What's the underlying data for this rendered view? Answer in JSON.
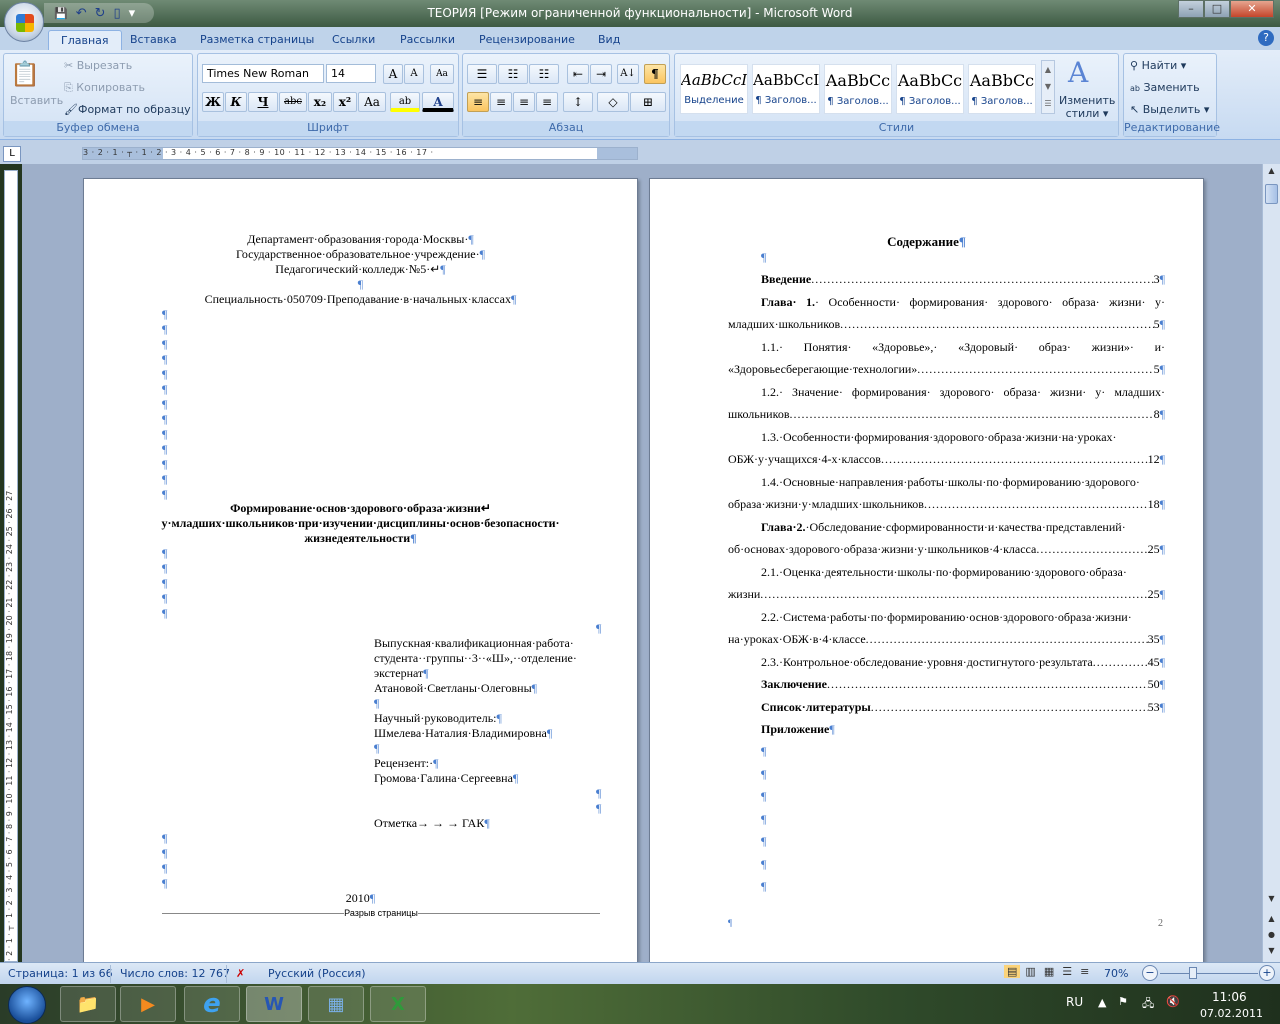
{
  "window": {
    "title": "ТЕОРИЯ [Режим ограниченной функциональности] - Microsoft Word",
    "minimize": "–",
    "maximize": "□",
    "close": "✕"
  },
  "qat": {
    "save": "💾",
    "undo": "↶",
    "redo": "↻",
    "new": "▯",
    "customize": "▾"
  },
  "tabs": [
    "Главная",
    "Вставка",
    "Разметка страницы",
    "Ссылки",
    "Рассылки",
    "Рецензирование",
    "Вид"
  ],
  "help": "?",
  "clipboard": {
    "paste": "Вставить",
    "cut": "Вырезать",
    "copy": "Копировать",
    "format_painter": "Формат по образцу",
    "label": "Буфер обмена"
  },
  "font": {
    "name": "Times New Roman",
    "size": "14",
    "grow": "A",
    "shrink": "A",
    "clear": "Aa",
    "bold": "Ж",
    "italic": "К",
    "underline": "Ч",
    "strike": "abc",
    "sub": "x₂",
    "sup": "x²",
    "case": "Aa",
    "highlight": "ab",
    "color": "A",
    "label": "Шрифт"
  },
  "paragraph": {
    "bullets": "☰",
    "numbering": "☷",
    "multilevel": "☷",
    "dec_indent": "⇤",
    "inc_indent": "⇥",
    "sort": "A↓",
    "show_marks": "¶",
    "align_left": "≡",
    "center": "≡",
    "align_right": "≡",
    "justify": "≡",
    "spacing": "↕",
    "shading": "◇",
    "borders": "⊞",
    "label": "Абзац"
  },
  "styles": {
    "items": [
      {
        "sample": "AaBbCcI",
        "name": "Выделение"
      },
      {
        "sample": "AaBbCcI",
        "name": "¶ Заголов..."
      },
      {
        "sample": "AaBbCc",
        "name": "¶ Заголов..."
      },
      {
        "sample": "AaBbCc",
        "name": "¶ Заголов..."
      },
      {
        "sample": "AaBbCc",
        "name": "¶ Заголов..."
      }
    ],
    "change": "Изменить стили ▾",
    "label": "Стили"
  },
  "editing": {
    "find": "Найти ▾",
    "replace": "Заменить",
    "select": "Выделить ▾",
    "label": "Редактирование"
  },
  "ruler": {
    "tab_selector": "L",
    "h": "3 · 2 · 1 · ┬ · 1 · 2 · 3 · 4 · 5 · 6 · 7 · 8 · 9 · 10 · 11 · 12 · 13 · 14 · 15 · 16 · 17 ·",
    "v": "· 2 · 1 · ┬ · 1 · 2 · 3 · 4 · 5 · 6 · 7 · 8 · 9 · 10 · 11 · 12 · 13 · 14 · 15 · 16 · 17 · 18 · 19 · 20 · 21 · 22 · 23 · 24 · 25 · 26 · 27 ·"
  },
  "page1": {
    "header": [
      "Департамент·образования·города·Москвы·",
      "Государственное·образовательное·учреждение·",
      "Педагогический·колледж·№5·↵",
      "",
      "Специальность·050709·Преподавание·в·начальных·классах"
    ],
    "title": [
      "Формирование·основ·здорового·образа·жизни↵",
      "у·младших·школьников·при·изучении·дисциплины·основ·безопасности·",
      "жизнедеятельности"
    ],
    "info": [
      "Выпускная·квалификационная·работа·",
      "студента··группы··3··«Ш»,··отделение·",
      "экстернат",
      "Атановой·Светланы·Олеговны",
      "",
      "Научный·руководитель:",
      "Шмелева·Наталия·Владимировна",
      "",
      "Рецензент:·",
      "Громова·Галина·Сергеевна"
    ],
    "mark": "Отметка→   →      →   ГАК",
    "year": "2010",
    "page_break": "Разрыв страницы",
    "pilcrow": "¶"
  },
  "page2": {
    "heading": "Содержание",
    "toc": [
      {
        "lines": [
          {
            "bold": "Введение",
            "text": "",
            "page": "3"
          }
        ]
      },
      {
        "lines": [
          {
            "bold": "Глава· 1.",
            "text": "· Особенности· формирования· здорового· образа· жизни· у·",
            "page": null
          },
          {
            "bold": "",
            "text": "младших·школьников",
            "page": "5"
          }
        ]
      },
      {
        "lines": [
          {
            "bold": "",
            "text": "1.1.·  Понятия·  «Здоровье»,·  «Здоровый·  образ·  жизни»·  и·",
            "page": null
          },
          {
            "bold": "",
            "text": "«Здоровьесберегающие·технологии»",
            "page": "5"
          }
        ]
      },
      {
        "lines": [
          {
            "bold": "",
            "text": "1.2.· Значение· формирования· здорового· образа· жизни· у· младших·",
            "page": null
          },
          {
            "bold": "",
            "text": "школьников",
            "page": "8"
          }
        ]
      },
      {
        "lines": [
          {
            "bold": "",
            "text": "1.3.·Особенности·формирования·здорового·образа·жизни·на·уроках·",
            "page": null
          },
          {
            "bold": "",
            "text": "ОБЖ·у·учащихся·4-х·классов",
            "page": "12"
          }
        ]
      },
      {
        "lines": [
          {
            "bold": "",
            "text": "1.4.·Основные·направления·работы·школы·по·формированию·здорового·",
            "page": null
          },
          {
            "bold": "",
            "text": "образа·жизни·у·младших·школьников",
            "page": "18"
          }
        ]
      },
      {
        "lines": [
          {
            "bold": "Глава·2.",
            "text": "·Обследование·сформированности·и·качества·представлений·",
            "page": null
          },
          {
            "bold": "",
            "text": "об·основах·здорового·образа·жизни·у·школьников·4·класса",
            "page": "25"
          }
        ]
      },
      {
        "lines": [
          {
            "bold": "",
            "text": "2.1.·Оценка·деятельности·школы·по·формированию·здорового·образа·",
            "page": null
          },
          {
            "bold": "",
            "text": "жизни",
            "page": "25"
          }
        ]
      },
      {
        "lines": [
          {
            "bold": "",
            "text": "2.2.·Система·работы·по·формированию·основ·здорового·образа·жизни·",
            "page": null
          },
          {
            "bold": "",
            "text": "на·уроках·ОБЖ·в·4·классе",
            "page": "35"
          }
        ]
      },
      {
        "lines": [
          {
            "bold": "",
            "text": "2.3.·Контрольное·обследование·уровня·достигнутого·результата",
            "page": "45"
          }
        ]
      },
      {
        "lines": [
          {
            "bold": "Заключение",
            "text": "",
            "page": "50"
          }
        ]
      },
      {
        "lines": [
          {
            "bold": "Список·литературы",
            "text": "",
            "page": "53"
          }
        ]
      },
      {
        "lines": [
          {
            "bold": "Приложение",
            "text": "",
            "page": ""
          }
        ]
      }
    ],
    "footer_mark": "¶",
    "page_number": "2"
  },
  "status": {
    "page": "Страница: 1 из 66",
    "words": "Число слов: 12 767",
    "language": "Русский (Россия)",
    "zoom": "70%",
    "zoom_level": 70,
    "minus": "−",
    "plus": "+"
  },
  "taskbar": {
    "lang": "RU",
    "time": "11:06",
    "date": "07.02.2011",
    "apps": [
      "📁",
      "▶",
      "e",
      "W",
      "▦",
      "X"
    ]
  },
  "colors": {
    "accent": "#15428b",
    "pilcrow": "#4a7fd0",
    "doc_bg": "#9eafc9"
  }
}
